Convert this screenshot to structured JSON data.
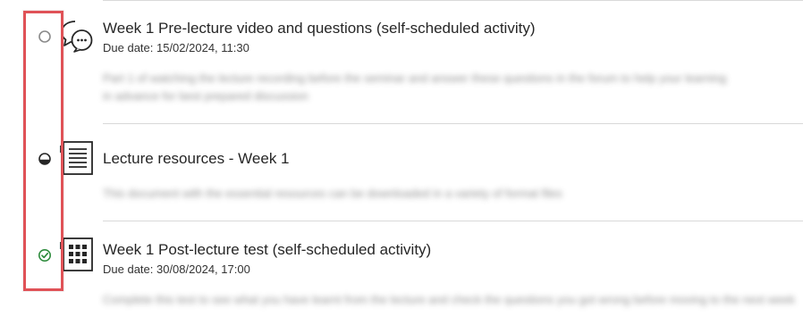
{
  "items": [
    {
      "title": "Week 1 Pre-lecture video and questions (self-scheduled activity)",
      "due": "Due date: 15/02/2024, 11:30",
      "desc_line1": "Part 1 of watching the lecture recording before the seminar and answer these questions in the forum to help your learning",
      "desc_line2": "in advance for best prepared discussion",
      "status": "not-started",
      "icon": "discussion-icon"
    },
    {
      "title": "Lecture resources - Week 1",
      "desc_line1": "This document with the essential resources can be downloaded in a variety of format files",
      "status": "in-progress",
      "icon": "document-icon"
    },
    {
      "title": "Week 1 Post-lecture test (self-scheduled activity)",
      "due": "Due date: 30/08/2024, 17:00",
      "desc_line1": "Complete this test to see what you have learnt from the lecture and check the questions you got wrong before moving to the next week",
      "status": "completed",
      "icon": "test-icon"
    }
  ],
  "colors": {
    "highlight": "#e05257",
    "completed": "#2e8b3d",
    "divider": "#d9d9d9"
  }
}
